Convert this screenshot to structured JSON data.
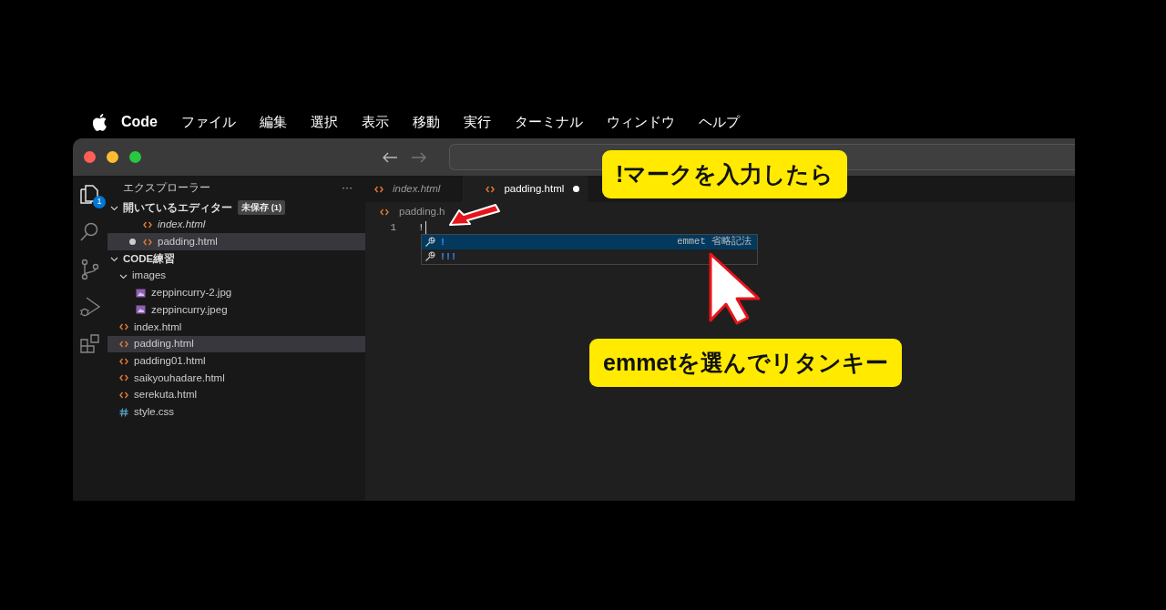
{
  "menubar": {
    "app": "Code",
    "items": [
      "ファイル",
      "編集",
      "選択",
      "表示",
      "移動",
      "実行",
      "ターミナル",
      "ウィンドウ",
      "ヘルプ"
    ]
  },
  "activity_bar": [
    {
      "kind": "explorer",
      "selected": true,
      "badge": "1"
    },
    {
      "kind": "search",
      "selected": false
    },
    {
      "kind": "source-control",
      "selected": false
    },
    {
      "kind": "run",
      "selected": false
    },
    {
      "kind": "extensions",
      "selected": false
    }
  ],
  "sidebar": {
    "title": "エクスプローラー",
    "more": "···",
    "open_editors": {
      "label": "開いているエディター",
      "badge": "未保存 (1)",
      "expanded": true,
      "items": [
        {
          "name": "index.html",
          "kind": "html",
          "preview": true,
          "modified": false,
          "selected": false
        },
        {
          "name": "padding.html",
          "kind": "html",
          "preview": false,
          "modified": true,
          "selected": true
        }
      ]
    },
    "folder": {
      "label": "CODE練習",
      "expanded": true,
      "children": [
        {
          "name": "images",
          "kind": "folder",
          "expanded": true,
          "selected": false,
          "children": [
            {
              "name": "zeppincurry-2.jpg",
              "kind": "image",
              "selected": false
            },
            {
              "name": "zeppincurry.jpeg",
              "kind": "image",
              "selected": false
            }
          ]
        },
        {
          "name": "index.html",
          "kind": "html",
          "selected": false
        },
        {
          "name": "padding.html",
          "kind": "html",
          "selected": true
        },
        {
          "name": "padding01.html",
          "kind": "html",
          "selected": false
        },
        {
          "name": "saikyouhadare.html",
          "kind": "html",
          "selected": false
        },
        {
          "name": "serekuta.html",
          "kind": "html",
          "selected": false
        },
        {
          "name": "style.css",
          "kind": "css",
          "selected": false
        }
      ]
    }
  },
  "editor": {
    "tabs": [
      {
        "label": "index.html",
        "preview": true,
        "modified": false,
        "selected": false
      },
      {
        "label": "padding.html",
        "preview": false,
        "modified": true,
        "selected": true
      }
    ],
    "breadcrumb": "padding.h",
    "lines": [
      {
        "number": "1",
        "text": "!"
      }
    ],
    "suggestions": [
      {
        "label": "!",
        "detail": "emmet 省略記法",
        "selected": true
      },
      {
        "label": "!!!",
        "selected": false
      }
    ]
  },
  "callouts": [
    {
      "text": "!マークを入力したら"
    },
    {
      "text": "emmetを選んでリタンキー"
    }
  ]
}
